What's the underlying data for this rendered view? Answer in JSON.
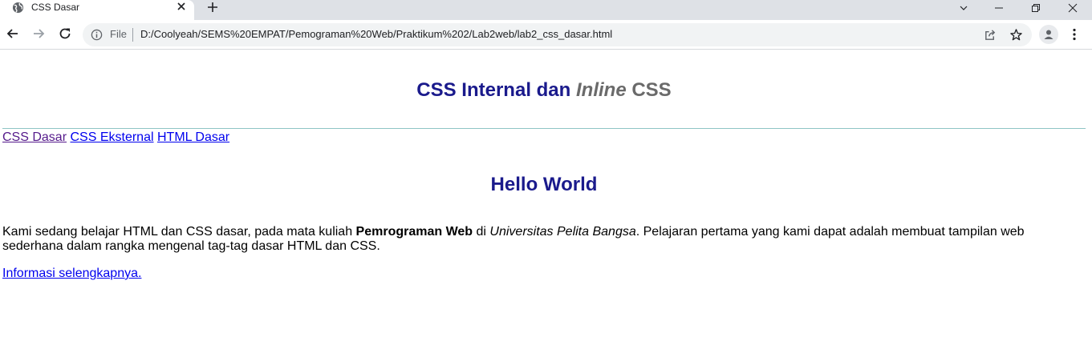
{
  "browser": {
    "tab": {
      "title": "CSS Dasar",
      "favicon_icon": "globe-icon",
      "close_icon": "close-icon"
    },
    "new_tab_icon": "plus-icon",
    "window_controls": [
      "chevron-down-icon",
      "minimize-icon",
      "restore-icon",
      "close-icon"
    ],
    "toolbar": {
      "back_icon": "arrow-left-icon",
      "forward_icon": "arrow-right-icon",
      "reload_icon": "reload-icon",
      "scheme_chip": "File",
      "url": "D:/Coolyeah/SEMS%20EMPAT/Pemograman%20Web/Praktikum%202/Lab2web/lab2_css_dasar.html",
      "share_icon": "share-icon",
      "bookmark_icon": "star-icon",
      "profile_icon": "person-icon",
      "menu_icon": "kebab-menu-icon"
    }
  },
  "page": {
    "header": {
      "title_main": "CSS Internal dan",
      "title_inline_italic": "Inline",
      "title_inline_rest": "CSS"
    },
    "nav_links": [
      {
        "label": "CSS Dasar",
        "visited": true
      },
      {
        "label": "CSS Eksternal",
        "visited": false
      },
      {
        "label": "HTML Dasar",
        "visited": false
      }
    ],
    "main": {
      "heading": "Hello World",
      "paragraph": {
        "part1": "Kami sedang belajar HTML dan CSS dasar, pada mata kuliah ",
        "bold": "Pemrograman Web",
        "part2": " di ",
        "italic": "Universitas Pelita Bangsa",
        "part3": ". Pelajaran pertama yang kami dapat adalah membuat tampilan web sederhana dalam rangka mengenal tag-tag dasar HTML dan CSS."
      },
      "more_link": "Informasi selengkapnya."
    }
  },
  "colors": {
    "heading": "#1a1a8c",
    "inline_css_gray": "#6a6a6a",
    "link_unvisited": "#0000ee",
    "link_visited": "#551a8b",
    "rule": "#8ec5c5",
    "tabstrip": "#dee1e6",
    "omnibox": "#f1f3f4"
  }
}
